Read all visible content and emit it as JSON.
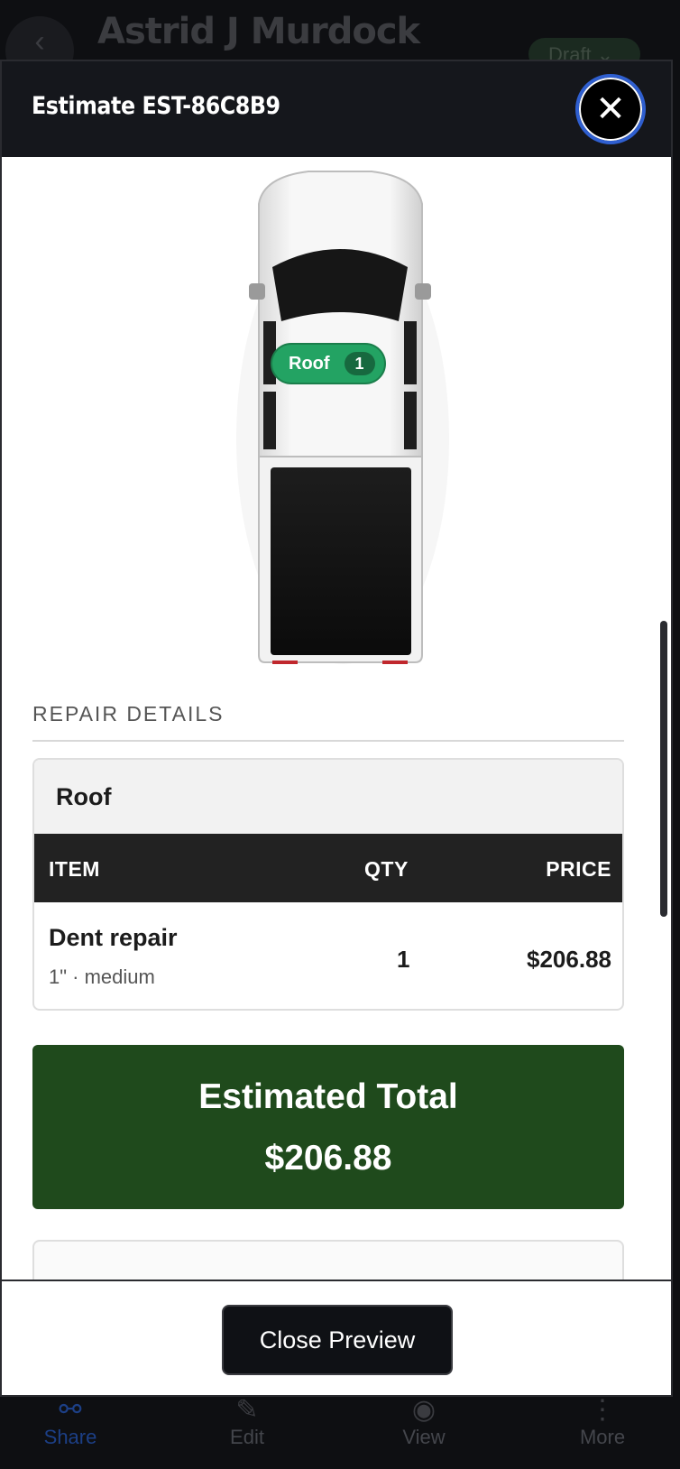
{
  "background": {
    "customer_name": "Astrid J Murdock",
    "status": "Draft",
    "back_icon": "chevron-left-icon",
    "tabs": [
      {
        "label": "Share",
        "icon": "share-icon",
        "active": true
      },
      {
        "label": "Edit",
        "icon": "pencil-icon",
        "active": false
      },
      {
        "label": "View",
        "icon": "eye-icon",
        "active": false
      },
      {
        "label": "More",
        "icon": "more-vertical-icon",
        "active": false
      }
    ]
  },
  "modal": {
    "title": "Estimate EST-86C8B9",
    "close_icon": "close-icon"
  },
  "vehicle": {
    "image": "pickup-truck-top-view",
    "damage_markers": [
      {
        "panel": "Roof",
        "count": "1",
        "color": "#23a363"
      }
    ]
  },
  "repair_details": {
    "section_title": "REPAIR DETAILS",
    "groups": [
      {
        "panel": "Roof",
        "columns": {
          "item": "ITEM",
          "qty": "QTY",
          "price": "PRICE"
        },
        "items": [
          {
            "name": "Dent repair",
            "detail": "1\" · medium",
            "qty": "1",
            "price": "$206.88"
          }
        ]
      }
    ]
  },
  "total": {
    "label": "Estimated Total",
    "value": "$206.88",
    "color": "#1f4a1c"
  },
  "footer": {
    "close_preview_label": "Close Preview"
  },
  "colors": {
    "accent_blue": "#2f5fd0",
    "marker_green": "#23a363",
    "total_green": "#1f4a1c",
    "header_dark": "#15171c"
  }
}
